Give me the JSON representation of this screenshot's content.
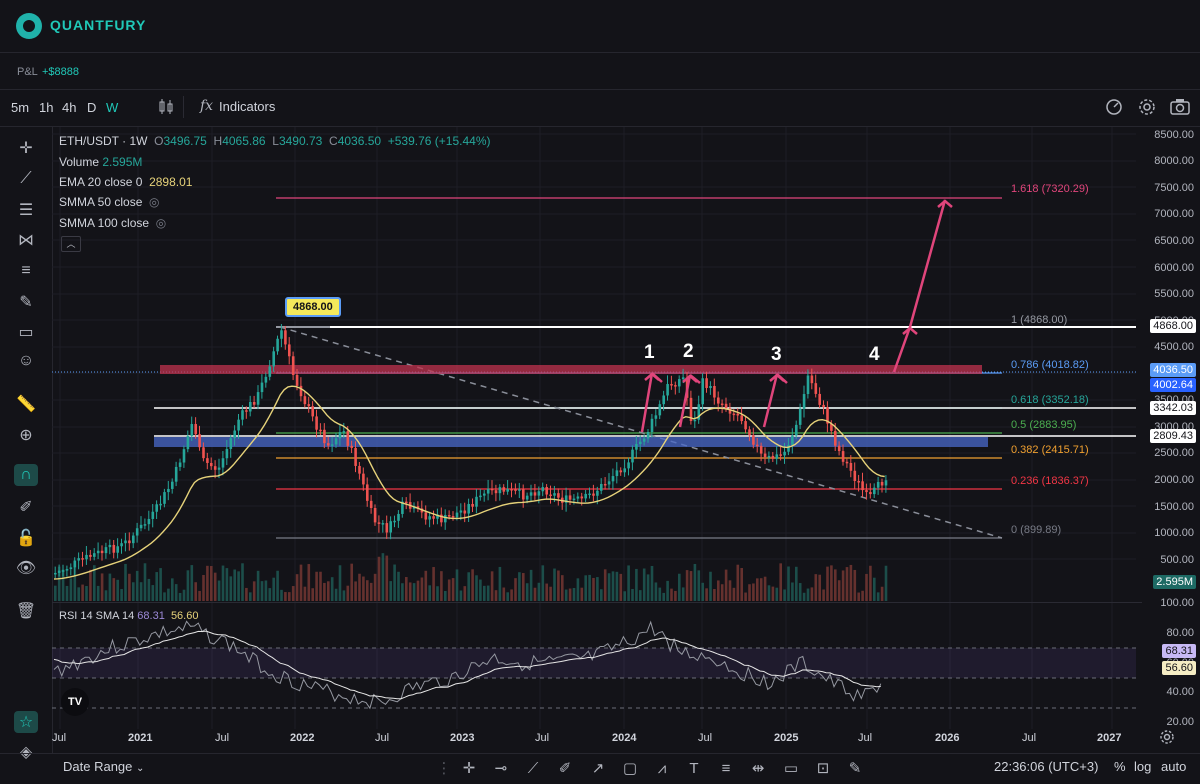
{
  "brand": {
    "name": "QUANTFURY"
  },
  "pnl": {
    "label": "P&L",
    "value": "+$8888"
  },
  "toolbar": {
    "timeframes": [
      "5m",
      "1h",
      "4h",
      "D",
      "W"
    ],
    "active_timeframe": "W",
    "indicators_label": "Indicators"
  },
  "legend": {
    "symbol": "ETH/USDT · 1W",
    "ohlc": {
      "o_label": "O",
      "o": "3496.75",
      "h_label": "H",
      "h": "4065.86",
      "l_label": "L",
      "l": "3490.73",
      "c_label": "C",
      "c": "4036.50",
      "change": "+539.76 (+15.44%)"
    },
    "volume_label": "Volume",
    "volume_value": "2.595M",
    "ema_label": "EMA 20 close 0",
    "ema_value": "2898.01",
    "smma50_label": "SMMA 50 close",
    "smma100_label": "SMMA 100 close"
  },
  "rsi": {
    "label": "RSI 14 SMA 14",
    "value1": "68.31",
    "value2": "56.60",
    "axis_ticks": [
      "100.00",
      "80.00",
      "60.00",
      "40.00",
      "20.00"
    ]
  },
  "price_axis": {
    "ticks": [
      "8500.00",
      "8000.00",
      "7500.00",
      "7000.00",
      "6500.00",
      "6000.00",
      "5500.00",
      "5000.00",
      "4500.00",
      "3500.00",
      "3000.00",
      "2500.00",
      "2000.00",
      "1500.00",
      "1000.00",
      "500.00"
    ],
    "labels": {
      "ath": "4868.00",
      "last": "4036.50",
      "level2": "4002.64",
      "line_3342": "3342.03",
      "line_2809": "2809.43",
      "volume": "2.595M"
    }
  },
  "annotations": {
    "ath_callout": "4868.00",
    "wave_numbers": [
      "1",
      "2",
      "3",
      "4"
    ]
  },
  "fib_levels": [
    {
      "label": "1.618 (7320.29)",
      "color": "#e0457b"
    },
    {
      "label": "1 (4868.00)",
      "color": "#9598a1"
    },
    {
      "label": "0.786 (4018.82)",
      "color": "#5b9cf6"
    },
    {
      "label": "0.618 (3352.18)",
      "color": "#26a69a"
    },
    {
      "label": "0.5 (2883.95)",
      "color": "#4caf50"
    },
    {
      "label": "0.382 (2415.71)",
      "color": "#f0a030"
    },
    {
      "label": "0.236 (1836.37)",
      "color": "#f23645"
    },
    {
      "label": "0 (899.89)",
      "color": "#787b86"
    }
  ],
  "time_axis": [
    "Jul",
    "2021",
    "Jul",
    "2022",
    "Jul",
    "2023",
    "Jul",
    "2024",
    "Jul",
    "2025",
    "Jul",
    "2026",
    "Jul",
    "2027"
  ],
  "bottom": {
    "date_range_label": "Date Range",
    "clock": "22:36:06 (UTC+3)",
    "percent": "%",
    "log": "log",
    "auto": "auto"
  },
  "colors": {
    "accent": "#20c8b8",
    "bull": "#26a69a",
    "bear": "#ef5350",
    "ema": "#e6d27a",
    "pink": "#e0457b"
  }
}
